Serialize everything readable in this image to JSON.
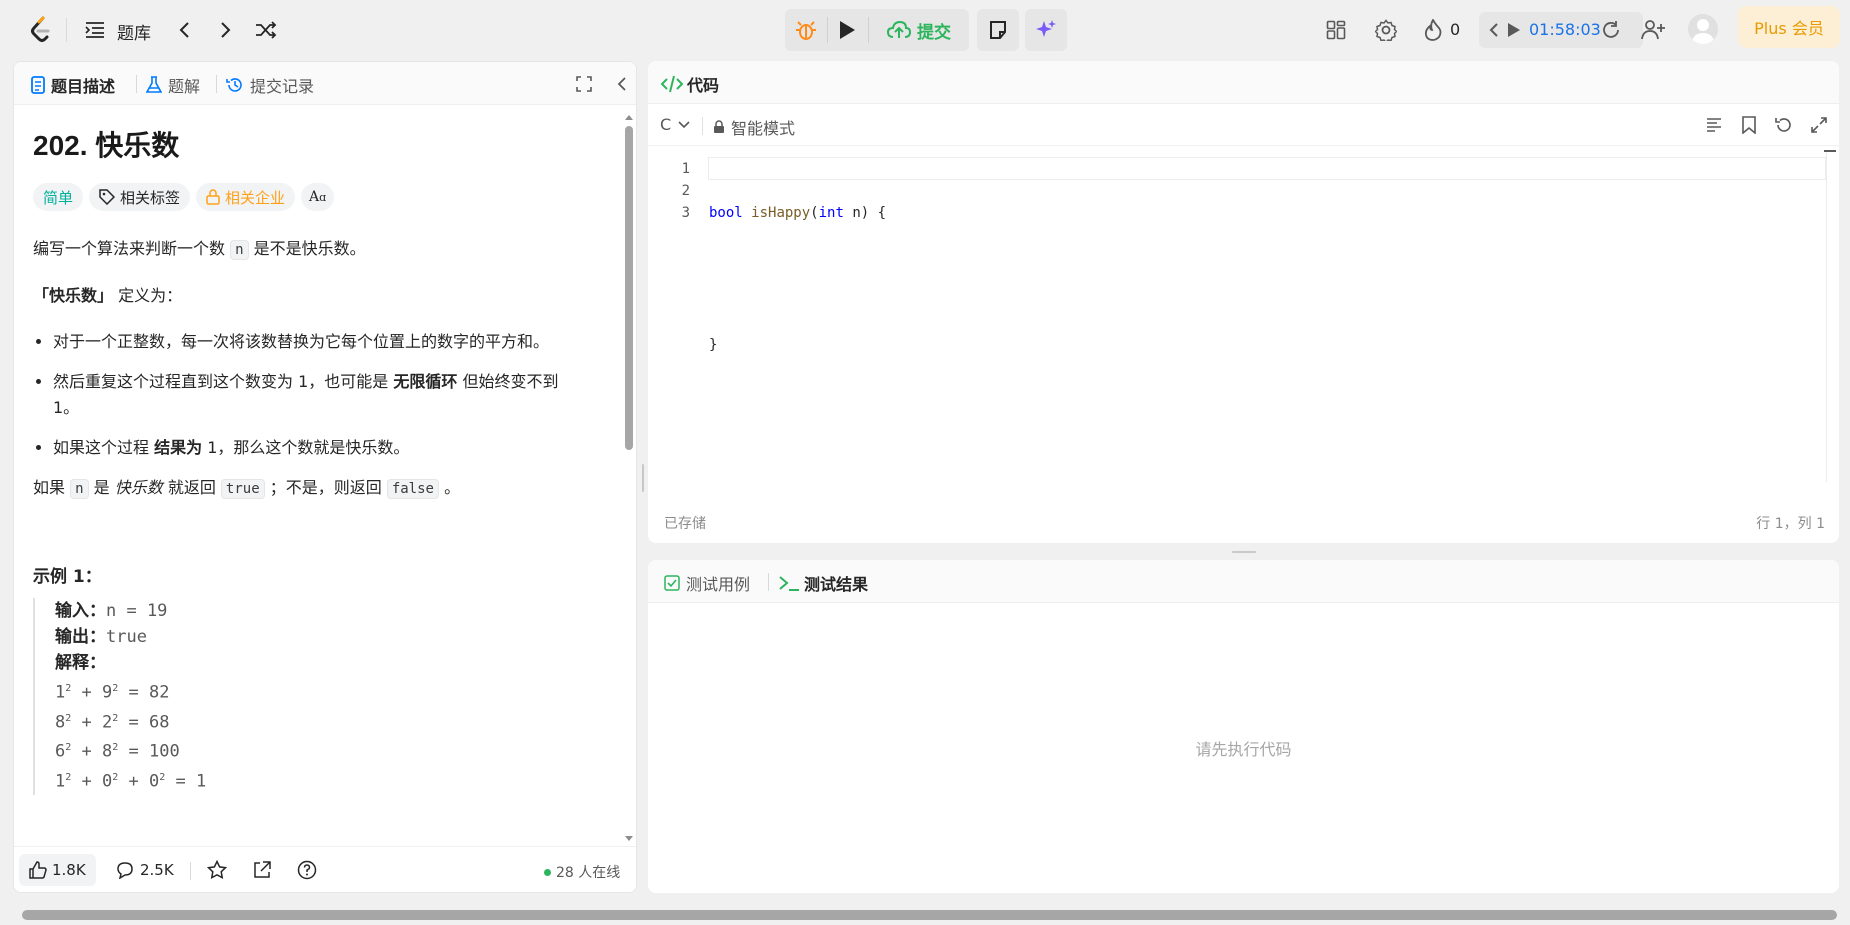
{
  "topbar": {
    "problems_label": "题库",
    "submit_label": "提交",
    "fire_count": "0",
    "timer": "01:58:03",
    "plus_label": "Plus 会员"
  },
  "left": {
    "tabs": [
      {
        "label": "题目描述"
      },
      {
        "label": "题解"
      },
      {
        "label": "提交记录"
      }
    ],
    "title": "202. 快乐数",
    "tags": {
      "difficulty": "简单",
      "topics": "相关标签",
      "companies": "相关企业"
    },
    "desc": {
      "p1_a": "编写一个算法来判断一个数",
      "p1_var": "n",
      "p1_b": "是不是快乐数。",
      "p2_strong": "「快乐数」",
      "p2_rest": " 定义为：",
      "bullet1": "对于一个正整数，每一次将该数替换为它每个位置上的数字的平方和。",
      "bullet2_a": "然后重复这个过程直到这个数变为 1，也可能是 ",
      "bullet2_strong": "无限循环",
      "bullet2_b": " 但始终变不到 1。",
      "bullet3_a": "如果这个过程 ",
      "bullet3_strong": "结果为",
      "bullet3_b": " 1，那么这个数就是快乐数。",
      "p3_a": "如果 ",
      "p3_var": "n",
      "p3_b": " 是 ",
      "p3_em": "快乐数",
      "p3_c": " 就返回 ",
      "p3_true": "true",
      "p3_d": " ；不是，则返回 ",
      "p3_false": "false",
      "p3_e": " 。"
    },
    "example1": {
      "heading": "示例 1：",
      "input_label": "输入：",
      "input_value": "n = 19",
      "output_label": "输出：",
      "output_value": "true",
      "explain_label": "解释：",
      "lines": [
        [
          "1",
          "9",
          "82"
        ],
        [
          "8",
          "2",
          "68"
        ],
        [
          "6",
          "8",
          "100"
        ]
      ],
      "last_line": [
        "1",
        "0",
        "0",
        "1"
      ]
    },
    "footer": {
      "likes": "1.8K",
      "comments": "2.5K",
      "online": "28 人在线"
    }
  },
  "editor": {
    "header_title": "代码",
    "language": "C",
    "mode": "智能模式",
    "line_numbers": [
      "1",
      "2",
      "3"
    ],
    "code": {
      "kw_bool": "bool",
      "fn": "isHappy",
      "paren_open": "(",
      "kw_int": "int",
      "param": " n) {",
      "close": "}"
    },
    "status_left": "已存储",
    "status_right": "行 1，列 1"
  },
  "results": {
    "tab_cases": "测试用例",
    "tab_results": "测试结果",
    "empty_text": "请先执行代码"
  },
  "colors": {
    "accent_green": "#2db55d",
    "link_blue": "#007aff",
    "easy": "#00af9b",
    "company_orange": "#ffa116",
    "plus_bg": "#fdefd6",
    "plus_text": "#e89b00"
  }
}
